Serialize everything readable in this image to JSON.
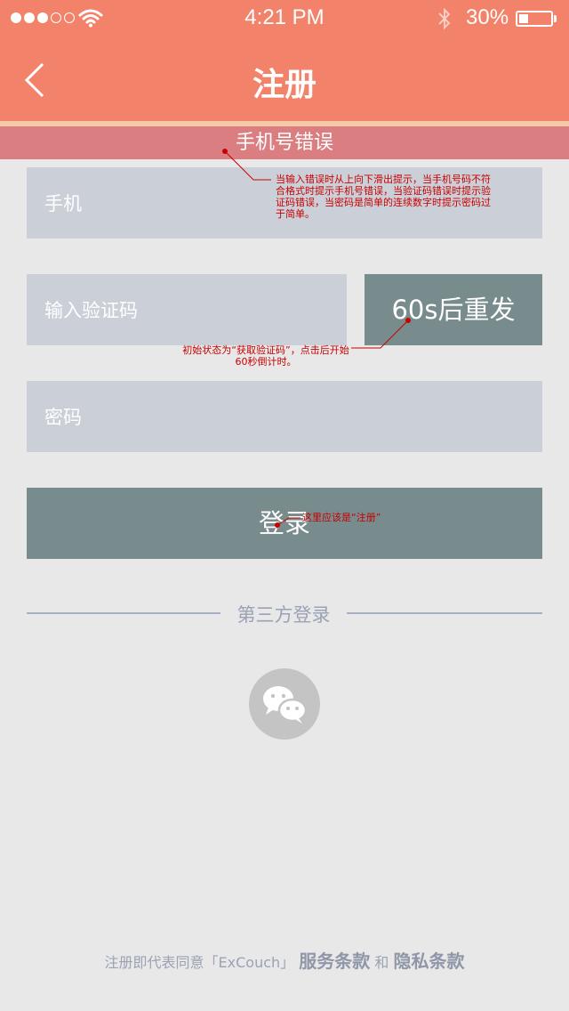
{
  "status_bar": {
    "time": "4:21 PM",
    "battery_percent": "30%",
    "battery_level": 0.3,
    "signal_bars_filled": 3,
    "signal_bars_total": 5,
    "icons": [
      "signal-dots-icon",
      "wifi-icon",
      "bluetooth-icon",
      "battery-icon"
    ]
  },
  "nav": {
    "title": "注册",
    "back_icon": "chevron-left-icon"
  },
  "error_banner": {
    "text": "手机号错误"
  },
  "form": {
    "phone_placeholder": "手机",
    "code_placeholder": "输入验证码",
    "password_placeholder": "密码",
    "resend_label": "60s后重发",
    "submit_label": "登录"
  },
  "third_party": {
    "label": "第三方登录",
    "icon": "wechat-icon"
  },
  "footer": {
    "prefix": "注册即代表同意「ExCouch」",
    "terms": "服务条款",
    "and": "和",
    "privacy": "隐私条款"
  },
  "annotations": {
    "banner_note": "当输入错误时从上向下滑出提示，当手机号码不符合格式时提示手机号错误，当验证码错误时提示验证码错误，当密码是简单的连续数字时提示密码过于简单。",
    "resend_note": "初始状态为“获取验证码”，点击后开始60秒倒计时。",
    "submit_note": "这里应该是“注册”"
  },
  "colors": {
    "header": "#f2826a",
    "header_stripe": "#f5c9a8",
    "error_banner": "#db7e82",
    "input_bg": "#cbd0d8",
    "button_bg": "#788b8d",
    "page_bg": "#e8e8e8",
    "annotation": "#c80000"
  }
}
